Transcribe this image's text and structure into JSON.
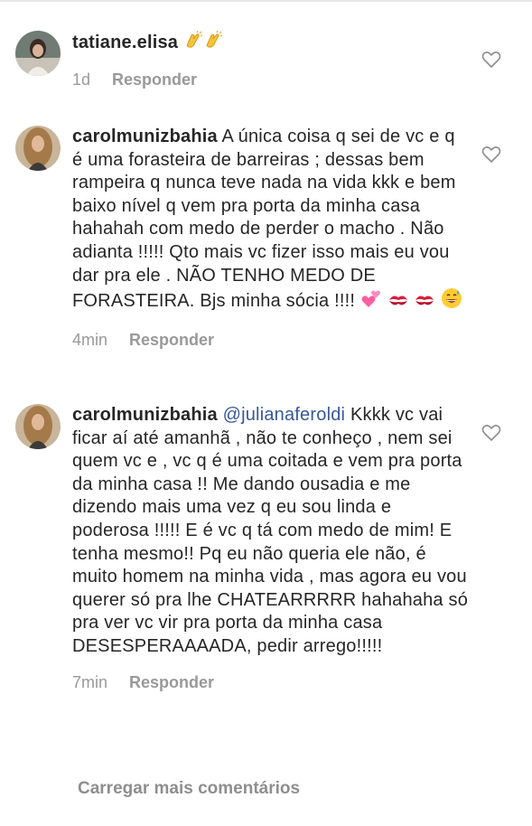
{
  "comments": [
    {
      "username": "tatiane.elisa",
      "text": "",
      "emojis": [
        "clapping-hands",
        "clapping-hands"
      ],
      "time": "1d",
      "reply_label": "Responder"
    },
    {
      "username": "carolmunizbahia",
      "text": "A única coisa q sei de vc e q é uma forasteira de barreiras ; dessas bem rampeira q nunca teve nada na vida kkk e bem baixo nível q vem pra porta da minha casa hahahah com medo de perder o macho . Não adianta !!!!! Qto mais vc fizer isso mais eu vou dar pra ele . NÃO TENHO MEDO DE FORASTEIRA. Bjs minha sócia !!!!",
      "emojis": [
        "two-hearts",
        "kiss-mark",
        "kiss-mark",
        "grinning-sweat"
      ],
      "time": "4min",
      "reply_label": "Responder"
    },
    {
      "username": "carolmunizbahia",
      "mention": "@julianaferoldi",
      "text": "Kkkk vc vai ficar aí até amanhã , não te conheço , nem sei quem vc e , vc q é uma coitada e vem pra porta da minha casa !! Me dando ousadia e me dizendo mais uma vez q eu sou linda e poderosa !!!!! E é vc q tá com medo de mim! E tenha mesmo!! Pq eu não queria ele não, é muito homem na minha vida , mas agora eu vou querer só pra lhe CHATEARRRRR hahahaha só pra ver vc vir pra porta da minha casa DESESPERAAAADA, pedir arrego!!!!!",
      "time": "7min",
      "reply_label": "Responder"
    }
  ],
  "load_more": "Carregar mais comentários",
  "colors": {
    "text": "#262626",
    "meta": "#999999",
    "mention": "#385898"
  }
}
